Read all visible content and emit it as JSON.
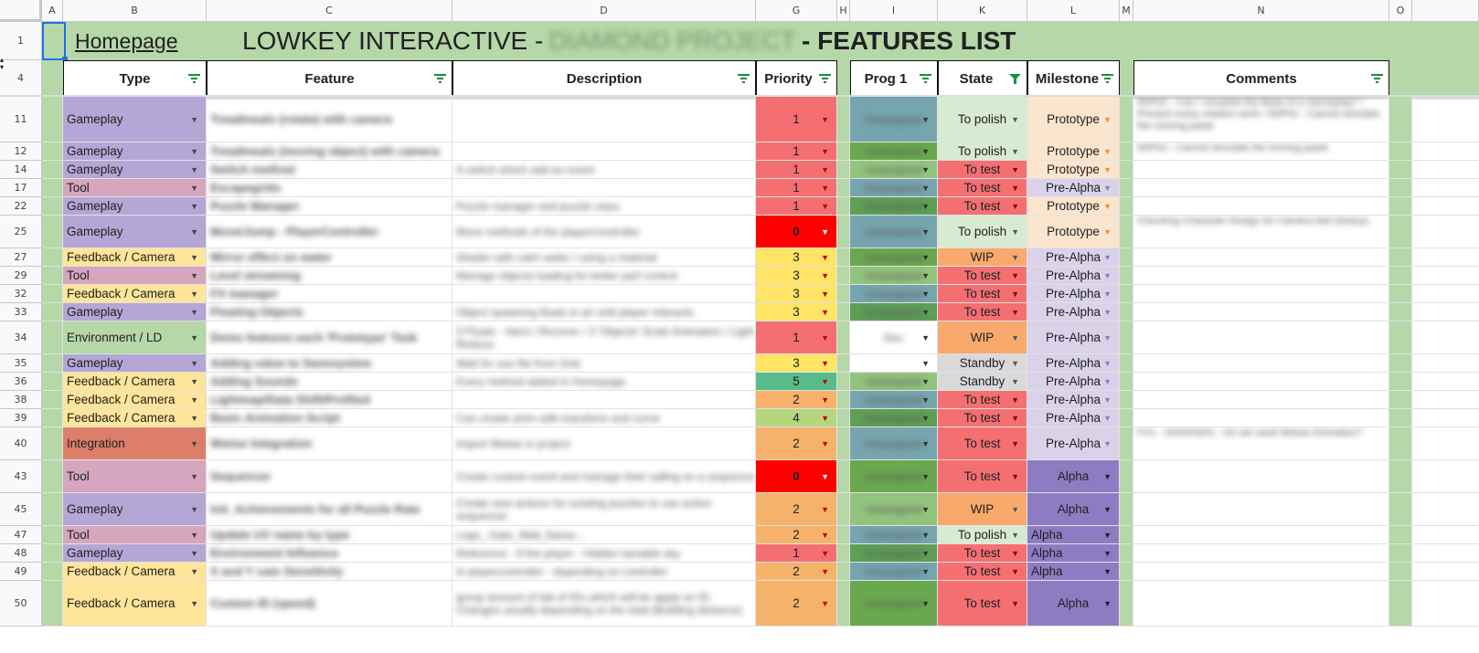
{
  "columns": [
    "A",
    "B",
    "C",
    "D",
    "G",
    "H",
    "I",
    "K",
    "L",
    "M",
    "N",
    "O"
  ],
  "row1": {
    "row_num": "1",
    "homepage": "Homepage",
    "title_prefix": "LOWKEY INTERACTIVE - ",
    "title_hidden": "DIAMOND PROJECT",
    "title_suffix": " - FEATURES LIST"
  },
  "row4": {
    "row_num": "4",
    "type": "Type",
    "feature": "Feature",
    "description": "Description",
    "priority": "Priority",
    "prog": "Prog 1",
    "state": "State",
    "milestone": "Milestone",
    "comments": "Comments"
  },
  "colors": {
    "accent_green": "#b6d7a8",
    "gameplay": "#b4a7d6",
    "tool": "#d5a6bd",
    "feedback": "#ffe599",
    "environment": "#b6d7a8",
    "integration": "#dd7e6b",
    "p0": "#ff0000",
    "p1": "#f46f72",
    "p2": "#f6b26b",
    "p3": "#ffe465",
    "p4": "#b5d67f",
    "p5": "#57bb8a",
    "state_polish": "#d9ead3",
    "state_test": "#f46f72",
    "state_wip": "#f9a96b",
    "state_standby": "#d9d9d9",
    "ms_prototype": "#fce5cd",
    "ms_prealpha": "#d9d2e9",
    "ms_alpha": "#8e7cc3"
  },
  "rows": [
    {
      "num": "11",
      "type": "Gameplay",
      "feature": "Treadmeals (rotate) with camera",
      "description": "",
      "priority": "1",
      "prog": "Unassigned",
      "state": "To polish",
      "milestone": "Prototype",
      "comments": "WIP02 - Can I visualise the Base of a Gameplay? / Prevent every rotation work / WIP02 - Cannot simulate the moving paste"
    },
    {
      "num": "12",
      "type": "Gameplay",
      "feature": "Treadmeals (moving object) with camera",
      "description": "",
      "priority": "1",
      "prog": "Unassigned",
      "state": "To polish",
      "milestone": "Prototype",
      "comments": "WIP02 - Cannot simulate the moving paste"
    },
    {
      "num": "14",
      "type": "Gameplay",
      "feature": "Switch method",
      "description": "A switch which add an event",
      "priority": "1",
      "prog": "Unassigned",
      "state": "To test",
      "milestone": "Prototype",
      "comments": ""
    },
    {
      "num": "17",
      "type": "Tool",
      "feature": "Escapegrids",
      "description": "",
      "priority": "1",
      "prog": "Unassigned",
      "state": "To test",
      "milestone": "Pre-Alpha",
      "comments": ""
    },
    {
      "num": "22",
      "type": "Gameplay",
      "feature": "Puzzle Manager",
      "description": "Puzzle manager and puzzle class",
      "priority": "1",
      "prog": "Unassigned",
      "state": "To test",
      "milestone": "Prototype",
      "comments": ""
    },
    {
      "num": "25",
      "type": "Gameplay",
      "feature": "Move/Jump - PlayerController",
      "description": "Move methods of the player/controller",
      "priority": "0",
      "prog": "Unassigned",
      "state": "To polish",
      "milestone": "Prototype",
      "comments": "Checking Character Design for Camera feel (heavy)"
    },
    {
      "num": "27",
      "type": "Feedback / Camera",
      "feature": "Mirror effect on water",
      "description": "Shader with calm water / using a material",
      "priority": "3",
      "prog": "Unassigned",
      "state": "WIP",
      "milestone": "Pre-Alpha",
      "comments": ""
    },
    {
      "num": "29",
      "type": "Tool",
      "feature": "Level streaming",
      "description": "Manage objects loading for better perf control",
      "priority": "3",
      "prog": "Unassigned",
      "state": "To test",
      "milestone": "Pre-Alpha",
      "comments": ""
    },
    {
      "num": "32",
      "type": "Feedback / Camera",
      "feature": "FX manager",
      "description": "",
      "priority": "3",
      "prog": "Unassigned",
      "state": "To test",
      "milestone": "Pre-Alpha",
      "comments": ""
    },
    {
      "num": "33",
      "type": "Gameplay",
      "feature": "Floating Objects",
      "description": "Object spawning floats in air until player interacts",
      "priority": "3",
      "prog": "Unassigned",
      "state": "To test",
      "milestone": "Pre-Alpha",
      "comments": ""
    },
    {
      "num": "34",
      "type": "Environment / LD",
      "feature": "Demo features each 'Prototype' Task",
      "description": "3 Floats - Varni / Recover / 3 'Objects' Scale Animation / Light Reduce",
      "priority": "1",
      "prog": "Dev",
      "state": "WIP",
      "milestone": "Pre-Alpha",
      "comments": ""
    },
    {
      "num": "35",
      "type": "Gameplay",
      "feature": "Adding value to Savesystem",
      "description": "Wait for use file from Grid",
      "priority": "3",
      "prog": "",
      "state": "Standby",
      "milestone": "Pre-Alpha",
      "comments": ""
    },
    {
      "num": "36",
      "type": "Feedback / Camera",
      "feature": "Adding Sounds",
      "description": "Every method added in Homepage",
      "priority": "5",
      "prog": "Unassigned",
      "state": "Standby",
      "milestone": "Pre-Alpha",
      "comments": ""
    },
    {
      "num": "38",
      "type": "Feedback / Camera",
      "feature": "Lightmap/Data Shift/Profiled",
      "description": "",
      "priority": "2",
      "prog": "Unassigned",
      "state": "To test",
      "milestone": "Pre-Alpha",
      "comments": ""
    },
    {
      "num": "39",
      "type": "Feedback / Camera",
      "feature": "Basic Animation Script",
      "description": "Can create anim with transform and curve",
      "priority": "4",
      "prog": "Unassigned",
      "state": "To test",
      "milestone": "Pre-Alpha",
      "comments": ""
    },
    {
      "num": "40",
      "type": "Integration",
      "feature": "Wwise Integration",
      "description": "Import Wwise in project",
      "priority": "2",
      "prog": "Unassigned",
      "state": "To test",
      "milestone": "Pre-Alpha",
      "comments": "FX1 - 2020/03/01 - Do we need Wwise Animation?"
    },
    {
      "num": "43",
      "type": "Tool",
      "feature": "Sequencer",
      "description": "Create custom event and manage their calling on a sequence",
      "priority": "0",
      "prog": "Unassigned",
      "state": "To test",
      "milestone": "Alpha",
      "comments": ""
    },
    {
      "num": "45",
      "type": "Gameplay",
      "feature": "Init_Achievements for all Puzzle Rate",
      "description": "Create new actions for existing puzzles to use action sequencer",
      "priority": "2",
      "prog": "Unassigned",
      "state": "WIP",
      "milestone": "Alpha",
      "comments": ""
    },
    {
      "num": "47",
      "type": "Tool",
      "feature": "Update UV name by type",
      "description": "Logs_ Gate_Wall_Name...",
      "priority": "2",
      "prog": "Unassigned",
      "state": "To polish",
      "milestone": "Alpha",
      "comments": ""
    },
    {
      "num": "48",
      "type": "Gameplay",
      "feature": "Environment Influence",
      "description": "Reference - If the player - Hidden tamable sky",
      "priority": "1",
      "prog": "Unassigned",
      "state": "To test",
      "milestone": "Alpha",
      "comments": ""
    },
    {
      "num": "49",
      "type": "Feedback / Camera",
      "feature": "X and Y cam Sensitivity",
      "description": "In playercontroller - depending on controller",
      "priority": "2",
      "prog": "Unassigned",
      "state": "To test",
      "milestone": "Alpha",
      "comments": ""
    },
    {
      "num": "50",
      "type": "Feedback / Camera",
      "feature": "Custom ID (speed)",
      "description": "group amount of tab of IDs which will be apply on ID. Changes usually depending on the total (Building distance)",
      "priority": "2",
      "prog": "Unassigned",
      "state": "To test",
      "milestone": "Alpha",
      "comments": ""
    }
  ]
}
